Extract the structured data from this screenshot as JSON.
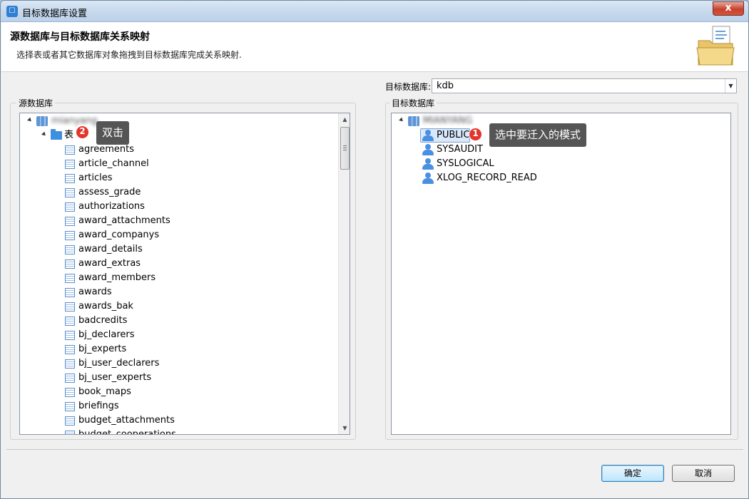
{
  "window": {
    "title": "目标数据库设置",
    "close_label": "x"
  },
  "header": {
    "title": "源数据库与目标数据库关系映射",
    "description": "选择表或者其它数据库对象拖拽到目标数据库完成关系映射."
  },
  "target_selector": {
    "label": "目标数据库:",
    "value": "kdb"
  },
  "source_panel": {
    "label": "源数据库",
    "root_name": "mianyang",
    "folder_label": "表",
    "tables": [
      "agreements",
      "article_channel",
      "articles",
      "assess_grade",
      "authorizations",
      "award_attachments",
      "award_companys",
      "award_details",
      "award_extras",
      "award_members",
      "awards",
      "awards_bak",
      "badcredits",
      "bj_declarers",
      "bj_experts",
      "bj_user_declarers",
      "bj_user_experts",
      "book_maps",
      "briefings",
      "budget_attachments",
      "budget_cooperations"
    ]
  },
  "target_panel": {
    "label": "目标数据库",
    "root_name": "MIANYANG",
    "schemas": [
      "PUBLIC",
      "SYSAUDIT",
      "SYSLOGICAL",
      "XLOG_RECORD_READ"
    ]
  },
  "callouts": [
    {
      "number": "1",
      "text": "选中要迁入的模式"
    },
    {
      "number": "2",
      "text": "双击"
    }
  ],
  "buttons": {
    "ok": "确定",
    "cancel": "取消"
  },
  "colors": {
    "badge": "#e4342b",
    "tooltip": "#555555",
    "selection": "#d9e8fb"
  }
}
